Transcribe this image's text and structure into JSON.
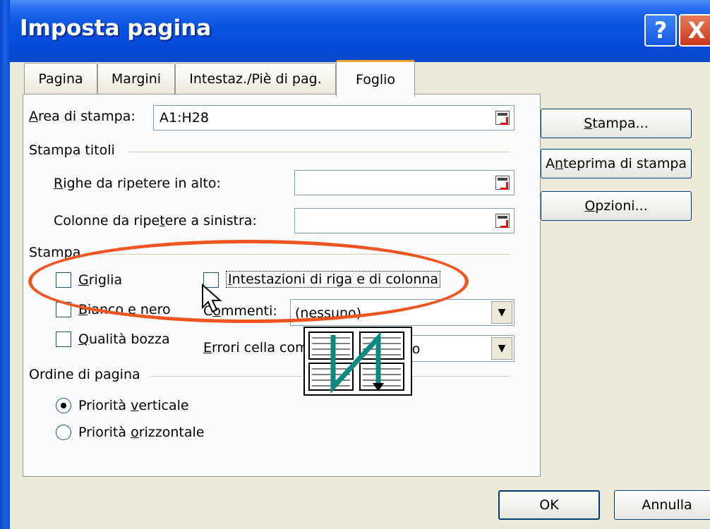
{
  "window": {
    "title": "Imposta pagina",
    "help_label": "?",
    "close_label": "X"
  },
  "tabs": [
    {
      "label": "Pagina"
    },
    {
      "label": "Margini"
    },
    {
      "label": "Intestaz./Piè di pag."
    },
    {
      "label": "Foglio",
      "selected": true
    }
  ],
  "print_area": {
    "label_u": "A",
    "label_rest": "rea di stampa:",
    "value": "A1:H28"
  },
  "print_titles": {
    "section": "Stampa titoli",
    "rows_label_u": "R",
    "rows_label_rest": "ighe da ripetere in alto:",
    "rows_value": "",
    "cols_label_pre": "Colonne da ripe",
    "cols_label_u": "t",
    "cols_label_post": "ere a sinistra:",
    "cols_value": ""
  },
  "print": {
    "section": "Stampa",
    "gridlines": {
      "pre": "",
      "u": "G",
      "post": "riglia",
      "checked": false
    },
    "black_white": {
      "pre": "",
      "u": "B",
      "post": "ianco e nero",
      "checked": false
    },
    "draft": {
      "pre": "",
      "u": "Q",
      "post": "ualità bozza",
      "checked": false
    },
    "headings": {
      "pre": "",
      "u": "I",
      "post": "ntestazioni di riga e di colonna",
      "checked": false
    },
    "comments": {
      "pre": "C",
      "u": "o",
      "post": "mmenti:",
      "value": "(nessuno)"
    },
    "errors": {
      "pre": "",
      "u": "E",
      "post": "rrori cella come:",
      "value": "visualizzato"
    }
  },
  "page_order": {
    "section": "Ordine di pagina",
    "down_then_over": {
      "pre": "Priorità ",
      "u": "v",
      "post": "erticale",
      "selected": true
    },
    "over_then_down": {
      "pre": "Priorità ",
      "u": "o",
      "post": "rizzontale",
      "selected": false
    }
  },
  "side_buttons": {
    "print": {
      "pre": "",
      "u": "S",
      "post": "tampa..."
    },
    "preview": {
      "pre": "A",
      "u": "n",
      "post": "teprima di stampa"
    },
    "options": {
      "pre": "",
      "u": "O",
      "post": "pzioni..."
    }
  },
  "footer": {
    "ok_label": "OK",
    "cancel_label": "Annulla"
  },
  "colors": {
    "highlight": "#ee5520",
    "accent_tab": "#f0a030",
    "titlebar": "#0a55e3"
  }
}
